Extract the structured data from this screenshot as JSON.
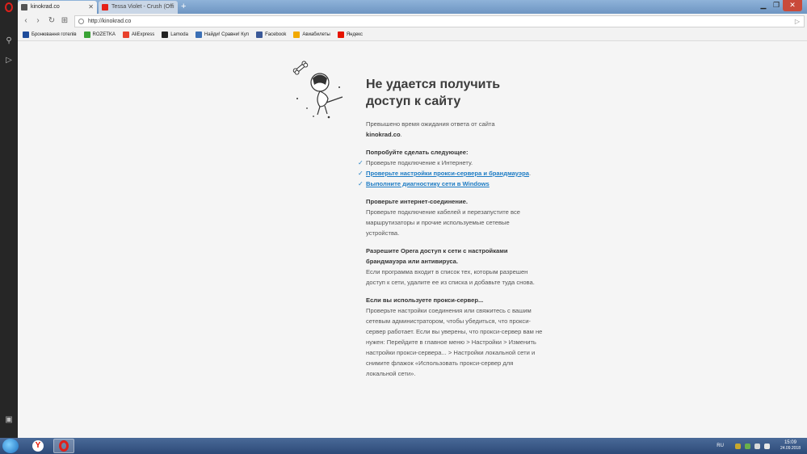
{
  "tabs": [
    {
      "title": "kinokrad.co",
      "active": true
    },
    {
      "title": "Tessa Violet - Crush (Offi",
      "active": false
    }
  ],
  "new_tab_label": "+",
  "address": {
    "url": "http://kinokrad.co"
  },
  "bookmarks": [
    {
      "label": "Бронювання готелів",
      "color": "#1e4c9a"
    },
    {
      "label": "ROZETKA",
      "color": "#3aa335"
    },
    {
      "label": "AliExpress",
      "color": "#e8412c"
    },
    {
      "label": "Lamoda",
      "color": "#222222"
    },
    {
      "label": "Найди! Сравни! Куп",
      "color": "#3a6fb5"
    },
    {
      "label": "Facebook",
      "color": "#3b5998"
    },
    {
      "label": "Авиабилеты",
      "color": "#f2a900"
    },
    {
      "label": "Яндекс",
      "color": "#e61400"
    }
  ],
  "error": {
    "heading": "Не удается получить доступ к сайту",
    "timeout_text": "Превышено время ожидания ответа от сайта",
    "site": "kinokrad.co",
    "site_suffix": ".",
    "try_title": "Попробуйте сделать следующее:",
    "try_items": [
      {
        "text": "Проверьте подключение к Интернету.",
        "link": false
      },
      {
        "text": "Проверьте настройки прокси-сервера и брандмауэра",
        "link": true,
        "suffix": "."
      },
      {
        "text": "Выполните диагностику сети в Windows",
        "link": true,
        "suffix": ""
      }
    ],
    "sections": [
      {
        "title": "Проверьте интернет-соединение.",
        "body": "Проверьте подключение кабелей и перезапустите все маршрутизаторы и прочие используемые сетевые устройства."
      },
      {
        "title": "Разрешите Opera доступ к сети с настройками брандмауэра или антивируса.",
        "body": "Если программа входит в список тех, которым разрешен доступ к сети, удалите ее из списка и добавьте туда снова."
      },
      {
        "title": "Если вы используете прокси-сервер...",
        "body": "Проверьте настройки соединения или свяжитесь с вашим сетевым администратором, чтобы убедиться, что прокси-сервер работает. Если вы уверены, что прокси-сервер вам не нужен: Перейдите в главное меню > Настройки > Изменить настройки прокси-сервера... > Настройки локальной сети и снимите флажок «Использовать прокси-сервер для локальной сети»."
      }
    ]
  },
  "taskbar": {
    "lang": "RU",
    "time": "15:09",
    "date": "24.09.2018"
  },
  "colors": {
    "link": "#1c7bc4",
    "opera_red": "#e0201b"
  }
}
